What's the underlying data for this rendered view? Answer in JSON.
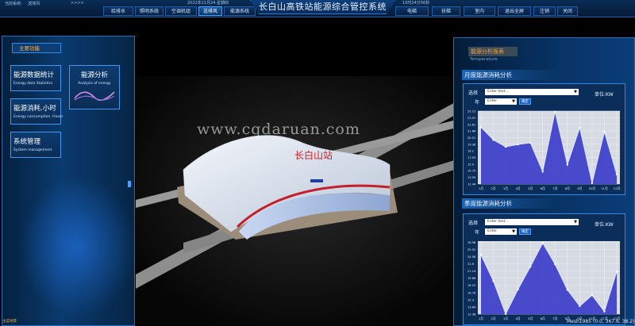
{
  "header": {
    "system_label": "当前系统:",
    "system_value": "送排风",
    "arrows": ">>>>",
    "datetime": "2022年11月24   星期四",
    "clock": "15时24分56秒",
    "title": "长白山高铁站能源综合管控系统",
    "nav_left": [
      "给排水",
      "照明系统",
      "空调机组",
      "送排风",
      "能源系统"
    ],
    "nav_right": [
      "电梯",
      "扶梯",
      "室内",
      "退出全屏",
      "注销",
      "关闭"
    ],
    "active_nav": "送排风"
  },
  "left_panel": {
    "tab": "主要功能",
    "buttons": [
      {
        "title": "能源数据统计",
        "subtitle": "Energy data Statistics"
      },
      {
        "title": "能源分析",
        "subtitle": "Analysis of energy"
      },
      {
        "title": "能源消耗.小时",
        "subtitle": "Energy consumption. Hours"
      },
      {
        "title": "系统管理",
        "subtitle": "System management"
      }
    ],
    "status": "主菜场景"
  },
  "scene": {
    "sign": "长白山站",
    "watermark": "www.cqdaruan.com",
    "mesh_info": "Mesh1985 (0.0, 367.6, 38.2)"
  },
  "right_panel": {
    "head": "能源分析报表",
    "sub": "Temperature",
    "monthly": {
      "title": "月度能源消耗分析",
      "select_label": "选择",
      "select_placeholder": "Enter text...",
      "year_label": "年",
      "year_placeholder": "Enter",
      "confirm": "确定",
      "unit": "单位:KW"
    },
    "quarterly": {
      "title": "季度能源消耗分析",
      "select_label": "选择",
      "select_placeholder": "Enter text...",
      "year_label": "年",
      "year_placeholder": "Enter",
      "confirm": "确定",
      "unit": "单位:KW"
    }
  },
  "colors": {
    "accent": "#2e88e6",
    "orange": "#f0a040",
    "area_fill": "#3838c8",
    "line": "#dfe9ff"
  },
  "chart_data": [
    {
      "type": "area",
      "title": "月度能源消耗分析",
      "ylabel": "单位:KW",
      "y_ticks": [
        12.44,
        13.59,
        14.75,
        15.9,
        17.05,
        18.2,
        19.36,
        20.51,
        21.66,
        22.81,
        23.97,
        25.12
      ],
      "categories": [
        "1月",
        "2月",
        "3月",
        "4月",
        "5月",
        "6月",
        "7月",
        "8月",
        "9月",
        "10月",
        "11月",
        "12月"
      ],
      "values": [
        22.3,
        20.1,
        18.9,
        19.3,
        19.6,
        14.6,
        25.0,
        15.8,
        22.2,
        12.6,
        21.5,
        14.1
      ],
      "ylim": [
        12.44,
        25.12
      ]
    },
    {
      "type": "area",
      "title": "季度能源消耗分析",
      "ylabel": "单位:KW",
      "y_ticks": [
        12.38,
        13.84,
        15.3,
        16.76,
        18.22,
        19.68,
        21.14,
        22.6,
        24.06,
        25.52,
        26.98
      ],
      "categories": [
        "1月",
        "2月",
        "3月",
        "4月",
        "5月",
        "6月",
        "7月",
        "8月",
        "9月",
        "10月",
        "11月",
        "12月"
      ],
      "values": [
        24.4,
        19.1,
        12.4,
        17.4,
        22.0,
        26.8,
        22.5,
        17.3,
        14.0,
        16.2,
        12.9,
        21.0
      ],
      "ylim": [
        12.38,
        27.2
      ]
    }
  ]
}
